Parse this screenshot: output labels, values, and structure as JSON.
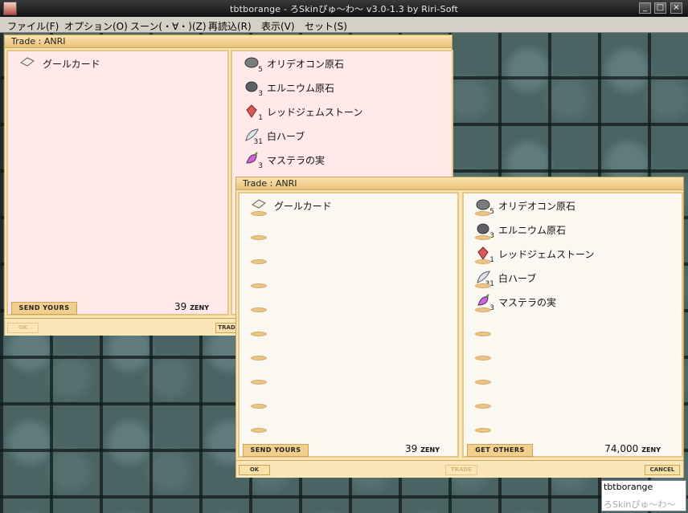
{
  "window": {
    "title": "tbtborange - ろSkinぴゅ〜わ〜 v3.0-1.3 by Riri-Soft",
    "minimize_glyph": "_",
    "maximize_glyph": "□",
    "close_glyph": "×"
  },
  "menu": [
    "ファイル(F)",
    "オプション(O)",
    "スーン(・∀・)(Z)",
    "再読込(R)",
    "表示(V)",
    "セット(S)"
  ],
  "trade_back": {
    "title": "Trade : ANRI",
    "my_items": [
      {
        "name": "グールカード",
        "icon": "card-icon"
      }
    ],
    "their_items": [
      {
        "name": "オリデオコン原石",
        "count": "5",
        "icon": "ore-icon"
      },
      {
        "name": "エルニウム原石",
        "count": "3",
        "icon": "ore-icon"
      },
      {
        "name": "レッドジェムストーン",
        "count": "1",
        "icon": "red-gem-icon"
      },
      {
        "name": "白ハーブ",
        "count": "31",
        "icon": "herb-icon"
      },
      {
        "name": "マステラの実",
        "count": "3",
        "icon": "fruit-icon"
      }
    ],
    "send_tab": "SEND YOURS",
    "my_zeny": "39",
    "zeny_unit": "ZENY",
    "ok_label": "OK",
    "trade_label": "TRAD"
  },
  "trade_front": {
    "title": "Trade : ANRI",
    "my_items": [
      {
        "name": "グールカード",
        "icon": "card-icon"
      }
    ],
    "their_items": [
      {
        "name": "オリデオコン原石",
        "count": "5",
        "icon": "ore-icon"
      },
      {
        "name": "エルニウム原石",
        "count": "3",
        "icon": "ore-icon"
      },
      {
        "name": "レッドジェムストーン",
        "count": "1",
        "icon": "red-gem-icon"
      },
      {
        "name": "白ハーブ",
        "count": "31",
        "icon": "herb-icon"
      },
      {
        "name": "マステラの実",
        "count": "3",
        "icon": "fruit-icon"
      }
    ],
    "send_tab": "SEND YOURS",
    "get_tab": "GET OTHERS",
    "my_zeny": "39",
    "their_zeny": "74,000",
    "zeny_unit": "ZENY",
    "ok_label": "OK",
    "trade_label": "TRADE",
    "cancel_label": "CANCEL"
  },
  "taskbar": {
    "line1": "tbtborange",
    "line2": "ろSkinぴゅ〜わ〜"
  }
}
